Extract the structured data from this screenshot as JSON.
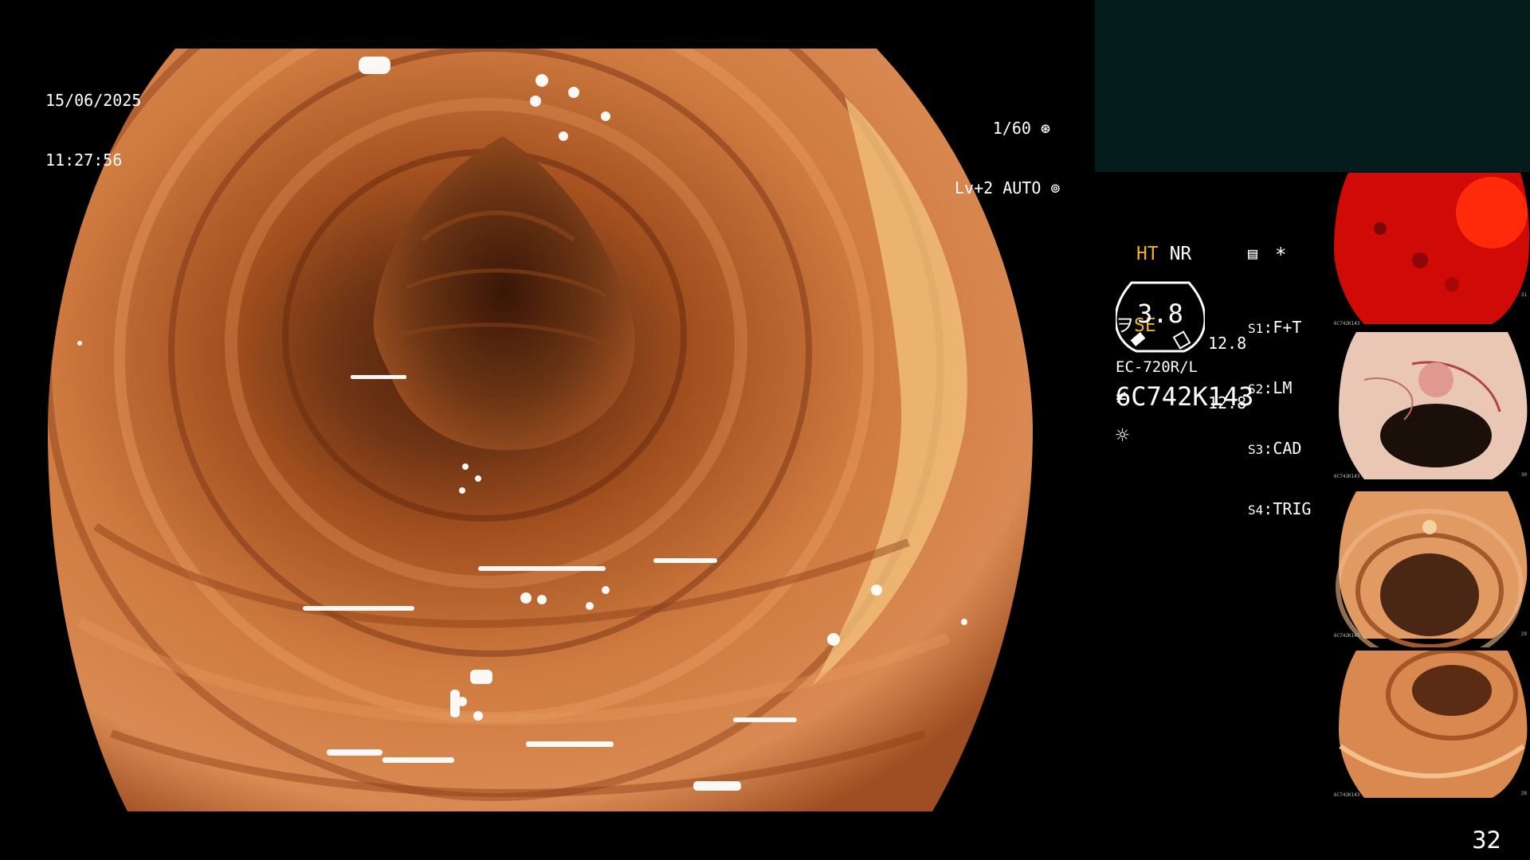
{
  "overlay": {
    "date": "15/06/2025",
    "time": "11:27:56",
    "shutter": "1/60",
    "iris_mode": "Lv+2 AUTO"
  },
  "settings": {
    "ht": "HT",
    "nr": "NR",
    "se": "SE",
    "asterisk": "*",
    "zoom_value": "3.8",
    "scale_top": "12.8",
    "scale_bottom": "12.8",
    "switches": [
      {
        "key": "S1",
        "value": "F+T"
      },
      {
        "key": "S2",
        "value": "LM"
      },
      {
        "key": "S3",
        "value": "CAD"
      },
      {
        "key": "S4",
        "value": "TRIG"
      }
    ],
    "scope_model": "EC-720R/L",
    "serial": "6C742K143"
  },
  "thumbnails": [
    {
      "name": "thumbnail-red-bleeding",
      "side_number": "31",
      "serial": "6C742K143"
    },
    {
      "name": "thumbnail-vascular-polyp",
      "side_number": "30",
      "serial": "6C742K143"
    },
    {
      "name": "thumbnail-lumen-polyp",
      "side_number": "29",
      "serial": "6C742K143"
    },
    {
      "name": "thumbnail-lumen-folds",
      "side_number": "28",
      "serial": "6C742K143"
    }
  ],
  "page_number": "32",
  "colors": {
    "accent_yellow": "#f0b427",
    "panel_teal": "#031c1b",
    "mucosa": "#c56a30"
  },
  "icons": [
    "shutter-icon",
    "iris-icon",
    "structure-enhance-icon",
    "color-icon",
    "memory-icon",
    "light-icon",
    "scope-gauge-icon"
  ]
}
